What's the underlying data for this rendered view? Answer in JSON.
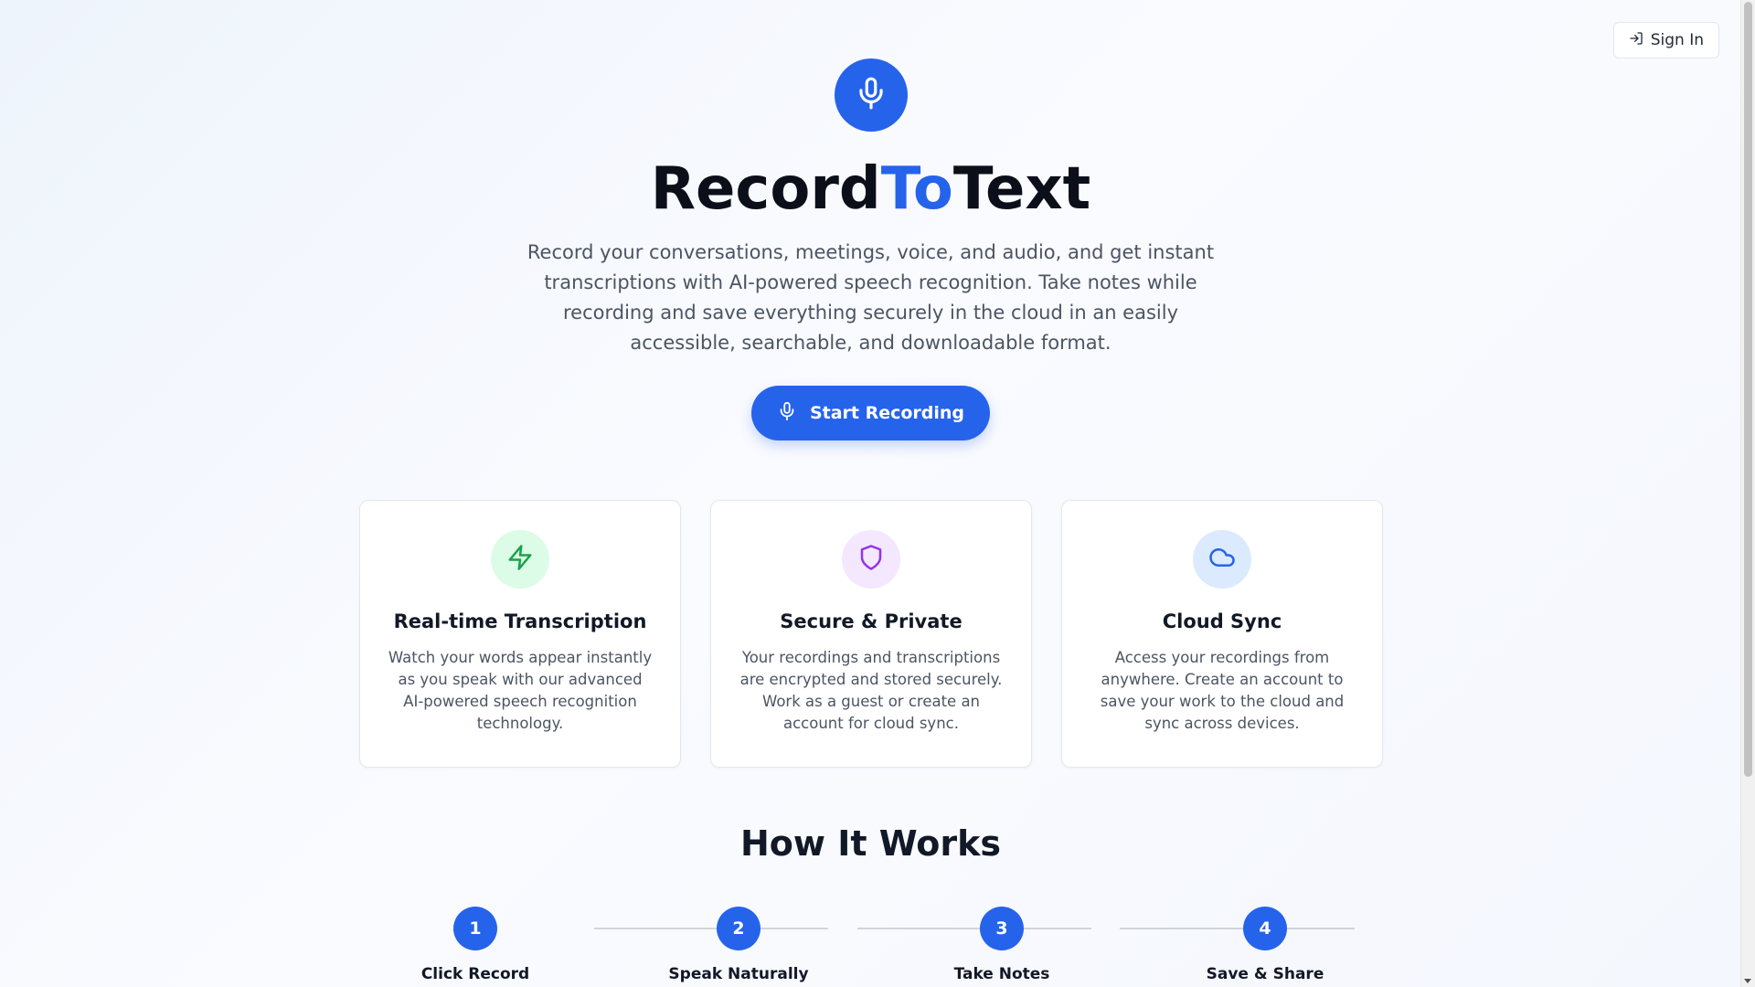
{
  "header": {
    "signin_label": "Sign In",
    "signin_icon": "log-in-icon"
  },
  "hero": {
    "icon": "microphone-icon",
    "title_part1": "Record",
    "title_accent": "To",
    "title_part2": "Text",
    "subtitle": "Record your conversations, meetings, voice, and audio, and get instant transcriptions with AI-powered speech recognition. Take notes while recording and save everything securely in the cloud in an easily accessible, searchable, and downloadable format.",
    "cta_label": "Start Recording",
    "accent_color": "#2563eb"
  },
  "features": [
    {
      "icon": "zap-icon",
      "icon_color": "#16a34a",
      "icon_bg": "#dcfce7",
      "title": "Real-time Transcription",
      "description": "Watch your words appear instantly as you speak with our advanced AI-powered speech recognition technology."
    },
    {
      "icon": "shield-icon",
      "icon_color": "#9333ea",
      "icon_bg": "#f3e8ff",
      "title": "Secure & Private",
      "description": "Your recordings and transcriptions are encrypted and stored securely. Work as a guest or create an account for cloud sync."
    },
    {
      "icon": "cloud-icon",
      "icon_color": "#2563eb",
      "icon_bg": "#dbeafe",
      "title": "Cloud Sync",
      "description": "Access your recordings from anywhere. Create an account to save your work to the cloud and sync across devices."
    }
  ],
  "how_it_works": {
    "title": "How It Works",
    "steps": [
      {
        "number": "1",
        "label": "Click Record"
      },
      {
        "number": "2",
        "label": "Speak Naturally"
      },
      {
        "number": "3",
        "label": "Take Notes"
      },
      {
        "number": "4",
        "label": "Save & Share"
      }
    ]
  }
}
